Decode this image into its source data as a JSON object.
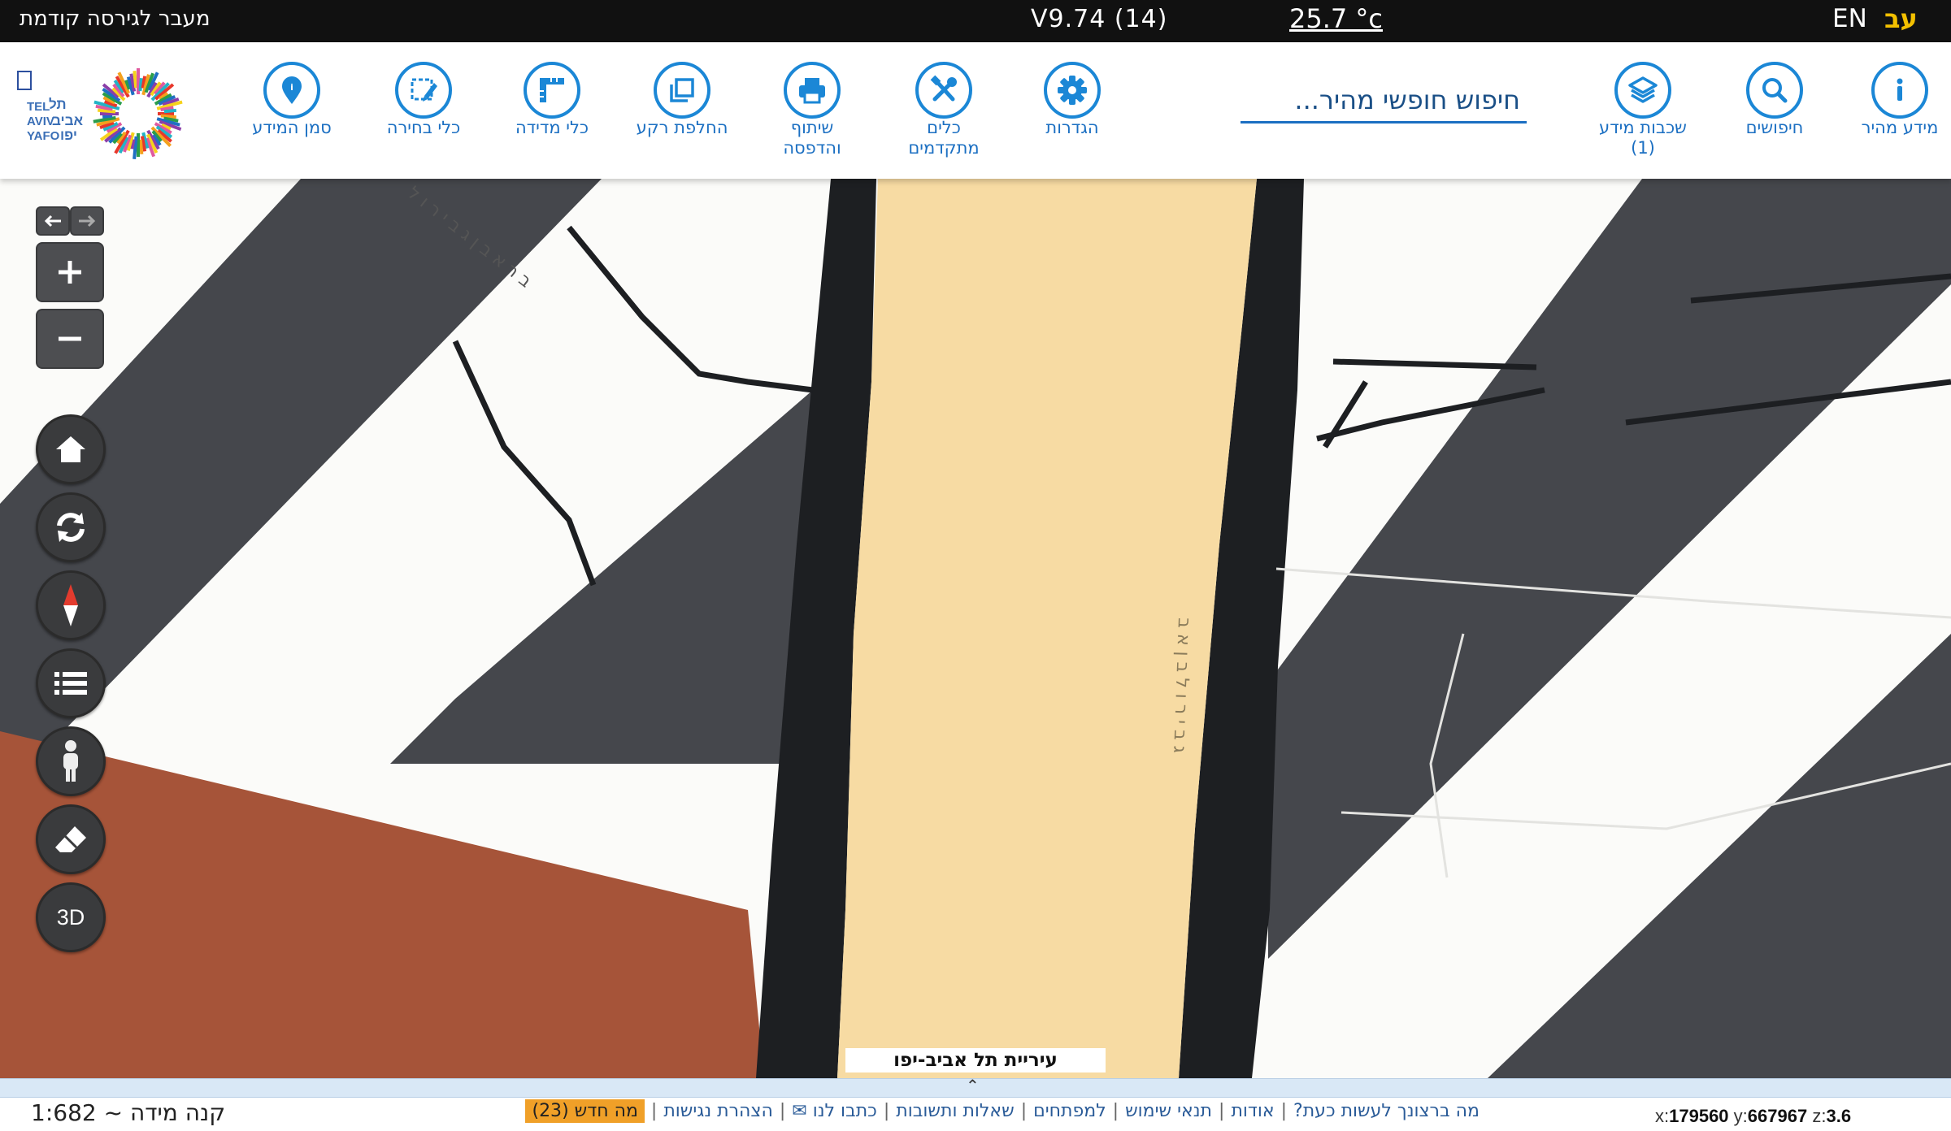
{
  "topbar": {
    "previous_version": "מעבר לגירסה קודמת",
    "version": "V9.74 (14)",
    "temperature": "25.7 °c",
    "lang_en": "EN",
    "lang_he": "עב"
  },
  "toolbar": {
    "tools": [
      {
        "id": "quick-info",
        "label": "מידע מהיר",
        "icon": "info-icon"
      },
      {
        "id": "searches",
        "label": "חיפושים",
        "icon": "search-icon"
      },
      {
        "id": "layers",
        "label": "שכבות מידע",
        "sub": "(1)",
        "icon": "layers-icon"
      },
      {
        "id": "settings",
        "label": "הגדרות",
        "icon": "gear-icon"
      },
      {
        "id": "advanced-tools",
        "label": "כלים",
        "sub": "מתקדמים",
        "icon": "tools-icon"
      },
      {
        "id": "share-print",
        "label": "שיתוף",
        "sub": "והדפסה",
        "icon": "print-icon"
      },
      {
        "id": "basemap",
        "label": "החלפת רקע",
        "icon": "basemap-icon"
      },
      {
        "id": "measure",
        "label": "כלי מדידה",
        "icon": "ruler-icon"
      },
      {
        "id": "select",
        "label": "כלי בחירה",
        "icon": "select-icon"
      },
      {
        "id": "marker",
        "label": "סמן המידע",
        "icon": "map-pin-icon"
      }
    ],
    "search_placeholder": "חיפוש חופשי מהיר..."
  },
  "logo": {
    "text_he_1": "תל",
    "text_he_2": "אביב",
    "text_he_3": "יפו",
    "text_en_1": "TEL",
    "text_en_2": "AVIV",
    "text_en_3": "YAFO"
  },
  "map": {
    "city_label": "עיריית תל אביב-יפו",
    "street_label_1": "ב ר א ב ן ג ב י ר ו ל",
    "street_label_2": "ג ב י ר ו ל ב ן א ב",
    "colors": {
      "road_dark": "#45474c",
      "road_black": "#1d1f22",
      "main_road": "#f7dba3",
      "building": "#a65439",
      "background": "#fbfbf9"
    },
    "controls": [
      "back-arrow-icon",
      "forward-arrow-icon",
      "zoom-in-icon",
      "zoom-out-icon",
      "home-icon",
      "refresh-icon",
      "compass-icon",
      "legend-list-icon",
      "street-view-person-icon",
      "eraser-icon"
    ],
    "control_3d": "3D"
  },
  "footer": {
    "scale_text": "קנה מידה ~ 1:682",
    "links": {
      "what_to_do": "מה ברצונך לעשות כעת?",
      "about": "אודות",
      "terms": "תנאי שימוש",
      "developers": "למפתחים",
      "faq": "שאלות ותשובות",
      "contact": "כתבו לנו ✉",
      "accessibility": "הצהרת נגישות",
      "whats_new": "מה חדש (23)"
    },
    "coords": {
      "x_label": "x:",
      "x": "179560",
      "y_label": "y:",
      "y": "667967",
      "z_label": "z:",
      "z": "3.6"
    }
  }
}
